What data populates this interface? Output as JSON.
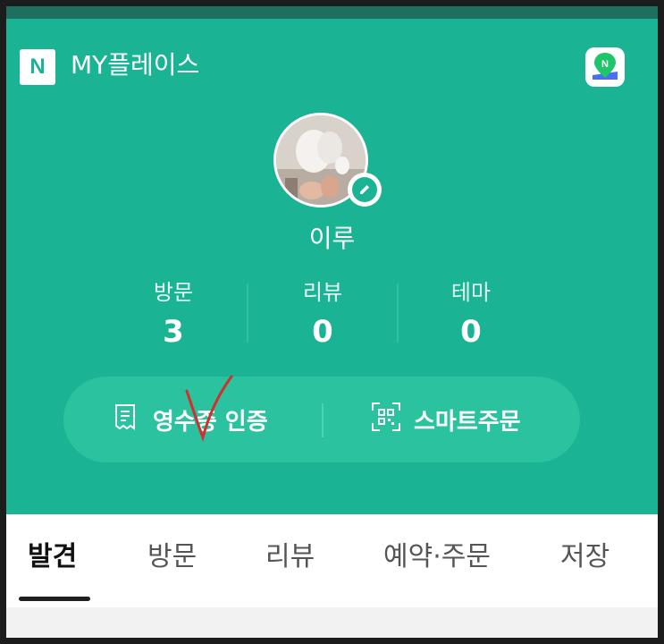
{
  "header": {
    "logo_letter": "N",
    "title": "MY플레이스",
    "map_icon": "naver-map-icon"
  },
  "profile": {
    "username": "이루",
    "edit_icon": "pencil-icon"
  },
  "stats": [
    {
      "label": "방문",
      "value": "3"
    },
    {
      "label": "리뷰",
      "value": "0"
    },
    {
      "label": "테마",
      "value": "0"
    }
  ],
  "actions": {
    "receipt_label": "영수증 인증",
    "receipt_icon": "receipt-icon",
    "smart_order_label": "스마트주문",
    "smart_order_icon": "qr-code-icon"
  },
  "tabs": [
    {
      "label": "발견",
      "active": true
    },
    {
      "label": "방문",
      "active": false
    },
    {
      "label": "리뷰",
      "active": false
    },
    {
      "label": "예약·주문",
      "active": false
    },
    {
      "label": "저장",
      "active": false
    }
  ],
  "annotation": {
    "mark": "red-checkmark"
  },
  "colors": {
    "brand_green": "#1ab394",
    "pill_green": "#2ac29f",
    "check_red": "#d32f2f"
  }
}
